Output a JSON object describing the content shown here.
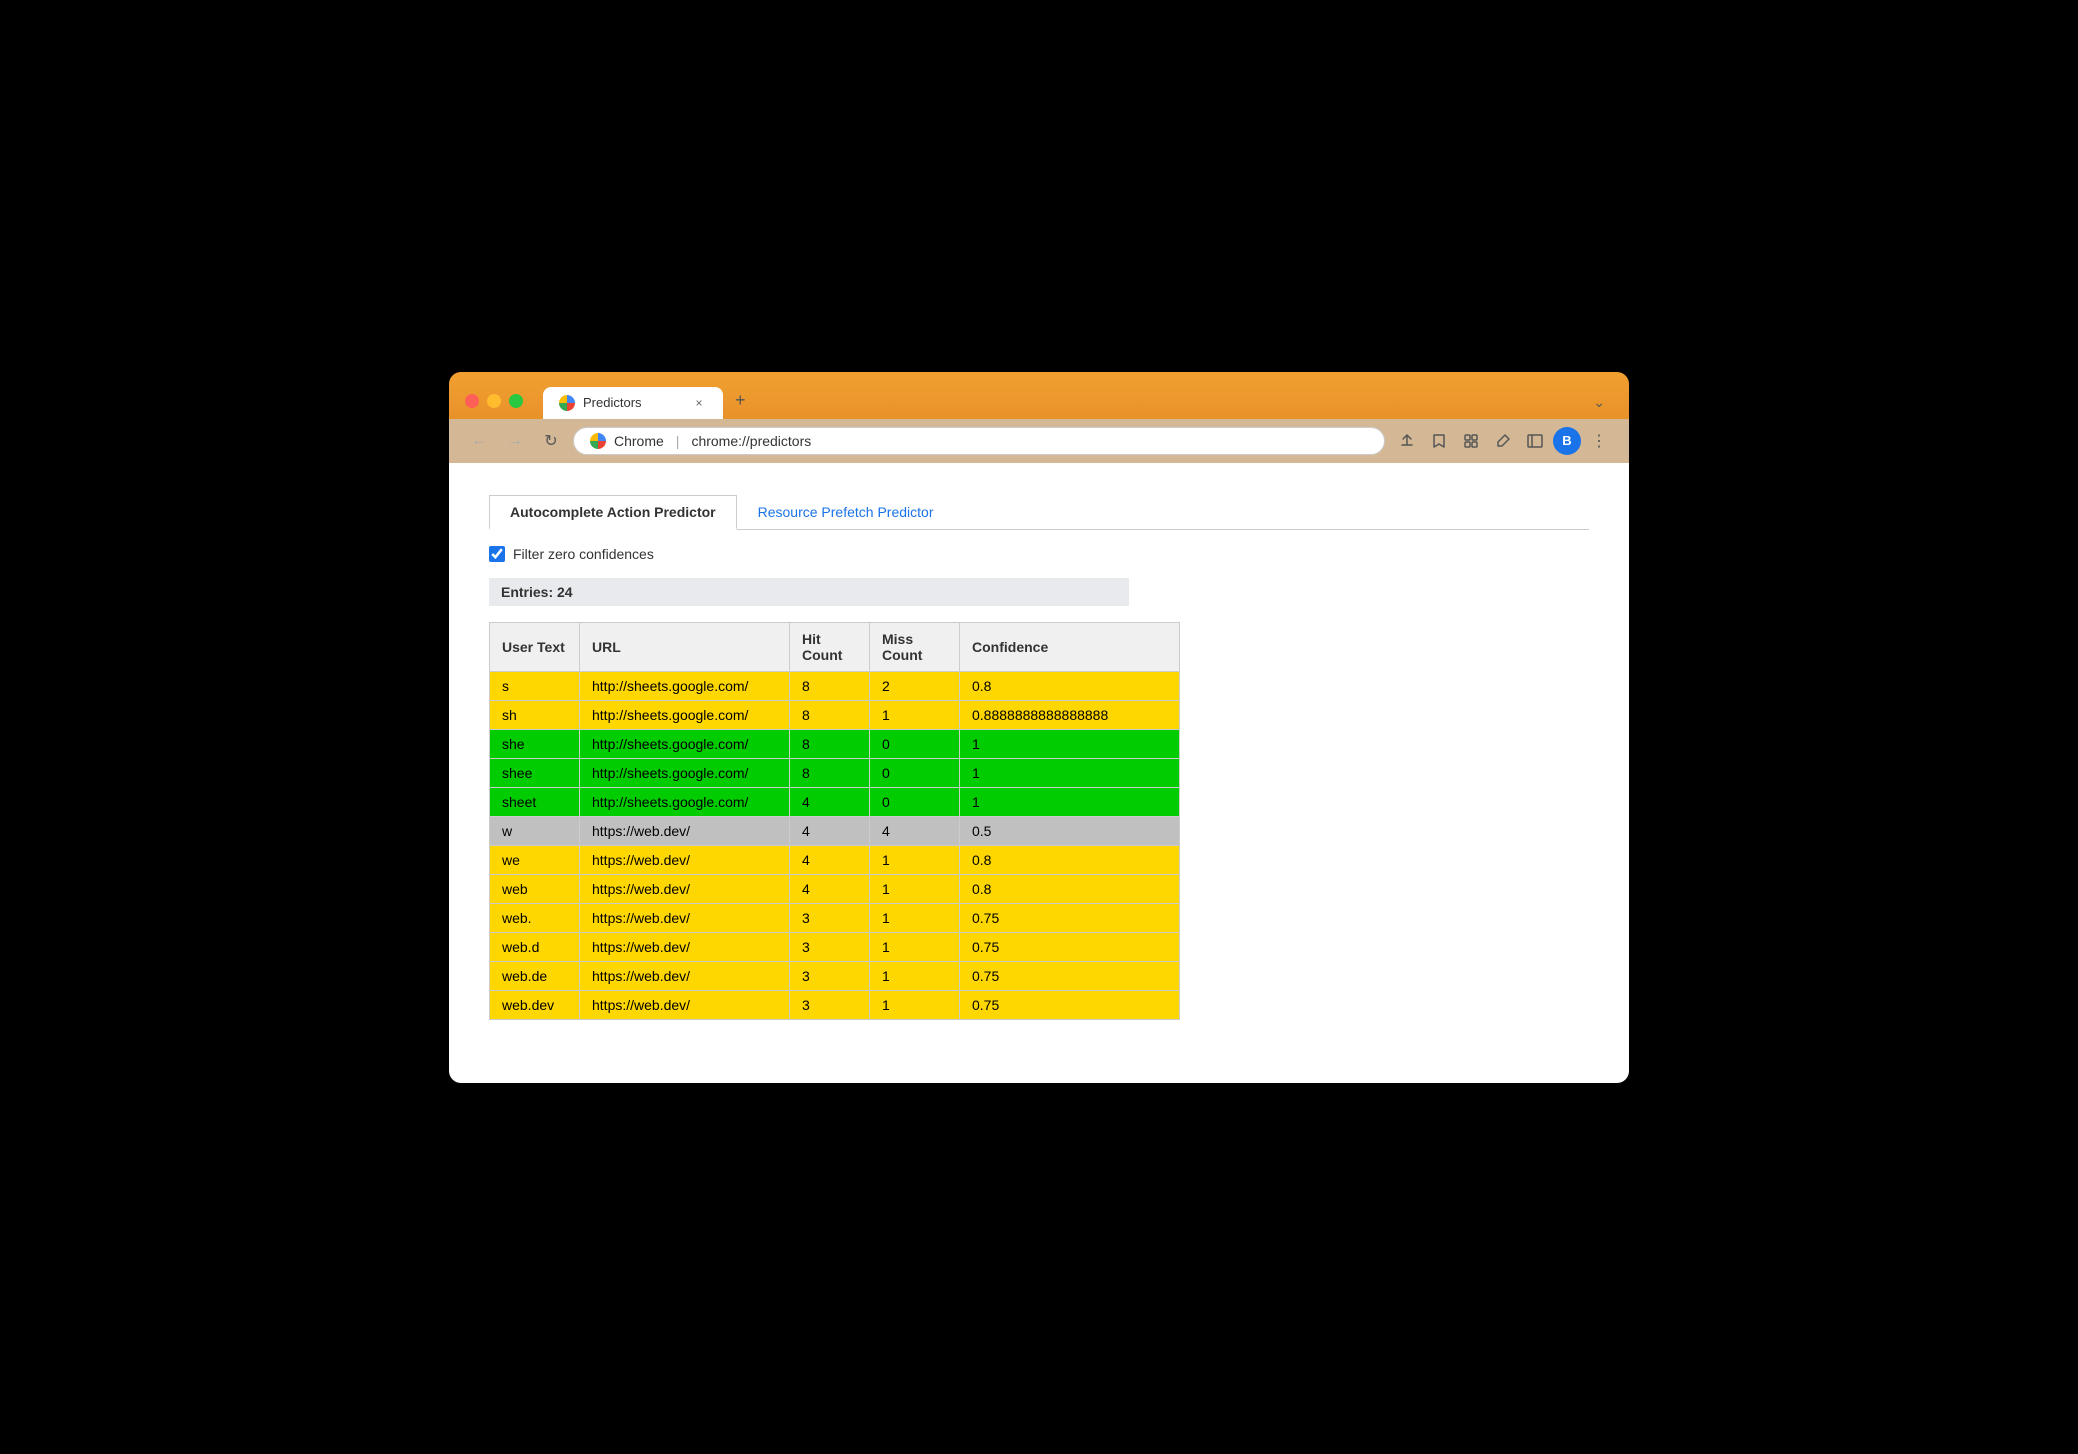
{
  "browser": {
    "tab_title": "Predictors",
    "tab_close": "×",
    "tab_new": "+",
    "tab_menu": "⌄",
    "nav_back": "←",
    "nav_forward": "→",
    "nav_reload": "↻",
    "address_site": "Chrome",
    "address_url": "chrome://predictors",
    "toolbar": {
      "share": "⬆",
      "bookmark": "☆",
      "extensions": "🧩",
      "pipette": "🧪",
      "sidebar": "▭",
      "profile": "B",
      "menu": "⋮"
    }
  },
  "page": {
    "tab_active": "Autocomplete Action Predictor",
    "tab_inactive": "Resource Prefetch Predictor",
    "filter_label": "Filter zero confidences",
    "entries_label": "Entries: 24",
    "columns": [
      "User Text",
      "URL",
      "Hit Count",
      "Miss Count",
      "Confidence"
    ],
    "rows": [
      {
        "user_text": "s",
        "url": "http://sheets.google.com/",
        "hit": "8",
        "miss": "2",
        "confidence": "0.8",
        "color": "yellow"
      },
      {
        "user_text": "sh",
        "url": "http://sheets.google.com/",
        "hit": "8",
        "miss": "1",
        "confidence": "0.8888888888888888",
        "color": "yellow"
      },
      {
        "user_text": "she",
        "url": "http://sheets.google.com/",
        "hit": "8",
        "miss": "0",
        "confidence": "1",
        "color": "green"
      },
      {
        "user_text": "shee",
        "url": "http://sheets.google.com/",
        "hit": "8",
        "miss": "0",
        "confidence": "1",
        "color": "green"
      },
      {
        "user_text": "sheet",
        "url": "http://sheets.google.com/",
        "hit": "4",
        "miss": "0",
        "confidence": "1",
        "color": "green"
      },
      {
        "user_text": "w",
        "url": "https://web.dev/",
        "hit": "4",
        "miss": "4",
        "confidence": "0.5",
        "color": "gray"
      },
      {
        "user_text": "we",
        "url": "https://web.dev/",
        "hit": "4",
        "miss": "1",
        "confidence": "0.8",
        "color": "yellow"
      },
      {
        "user_text": "web",
        "url": "https://web.dev/",
        "hit": "4",
        "miss": "1",
        "confidence": "0.8",
        "color": "yellow"
      },
      {
        "user_text": "web.",
        "url": "https://web.dev/",
        "hit": "3",
        "miss": "1",
        "confidence": "0.75",
        "color": "yellow"
      },
      {
        "user_text": "web.d",
        "url": "https://web.dev/",
        "hit": "3",
        "miss": "1",
        "confidence": "0.75",
        "color": "yellow"
      },
      {
        "user_text": "web.de",
        "url": "https://web.dev/",
        "hit": "3",
        "miss": "1",
        "confidence": "0.75",
        "color": "yellow"
      },
      {
        "user_text": "web.dev",
        "url": "https://web.dev/",
        "hit": "3",
        "miss": "1",
        "confidence": "0.75",
        "color": "yellow"
      }
    ]
  }
}
